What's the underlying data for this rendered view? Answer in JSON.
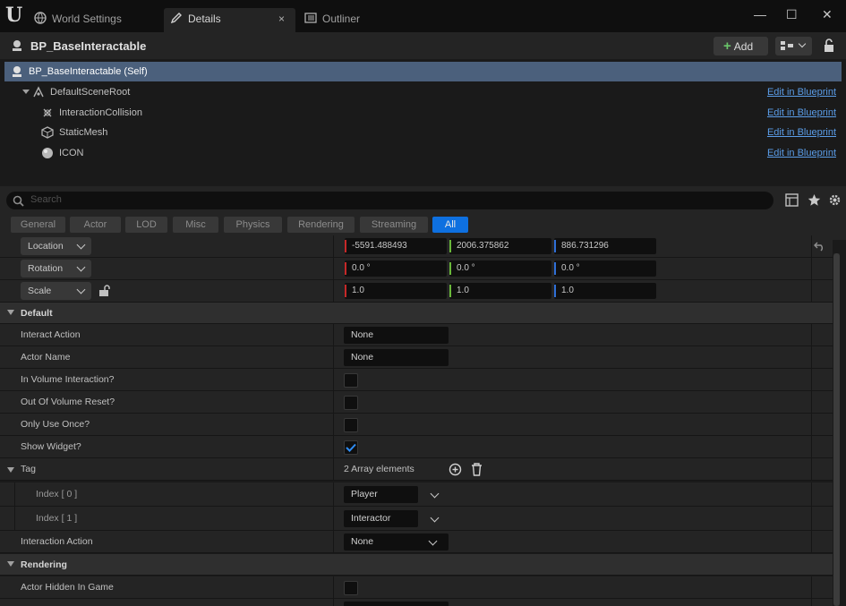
{
  "tabs": [
    {
      "label": "World Settings",
      "icon": "globe-icon"
    },
    {
      "label": "Details",
      "icon": "pencil-icon"
    },
    {
      "label": "Outliner",
      "icon": "outliner-icon"
    }
  ],
  "tab_close": "×",
  "window": {
    "minimize": "—",
    "maximize": "☐",
    "close": "✕"
  },
  "header": {
    "title": "BP_BaseInteractable",
    "add_label": "Add"
  },
  "tree": {
    "items": [
      {
        "label": "BP_BaseInteractable (Self)",
        "icon": "actor-icon",
        "link": ""
      },
      {
        "label": "DefaultSceneRoot",
        "icon": "scene-root-icon",
        "link": "Edit in Blueprint"
      },
      {
        "label": "InteractionCollision",
        "icon": "collision-icon",
        "link": "Edit in Blueprint"
      },
      {
        "label": "StaticMesh",
        "icon": "mesh-icon",
        "link": "Edit in Blueprint"
      },
      {
        "label": "ICON",
        "icon": "sphere-icon",
        "link": "Edit in Blueprint"
      }
    ]
  },
  "search": {
    "placeholder": "Search"
  },
  "filter_tabs": [
    "General",
    "Actor",
    "LOD",
    "Misc",
    "Physics",
    "Rendering",
    "Streaming",
    "All"
  ],
  "transform": {
    "location": {
      "label": "Location",
      "x": "-5591.488493",
      "y": "2006.375862",
      "z": "886.731296"
    },
    "rotation": {
      "label": "Rotation",
      "x": "0.0 °",
      "y": "0.0 °",
      "z": "0.0 °"
    },
    "scale": {
      "label": "Scale",
      "x": "1.0",
      "y": "1.0",
      "z": "1.0"
    }
  },
  "axis_colors": {
    "x": "#c62828",
    "y": "#6ab83a",
    "z": "#2f6fd6"
  },
  "default_section": {
    "title": "Default",
    "interact_action": {
      "label": "Interact Action",
      "value": "None"
    },
    "actor_name": {
      "label": "Actor Name",
      "value": "None"
    },
    "in_volume": {
      "label": "In Volume Interaction?",
      "checked": false
    },
    "out_of_volume": {
      "label": "Out Of Volume Reset?",
      "checked": false
    },
    "only_use_once": {
      "label": "Only Use Once?",
      "checked": false
    },
    "show_widget": {
      "label": "Show Widget?",
      "checked": true
    },
    "tag": {
      "label": "Tag",
      "count": "2 Array elements",
      "elements": [
        {
          "label": "Index [ 0 ]",
          "value": "Player"
        },
        {
          "label": "Index [ 1 ]",
          "value": "Interactor"
        }
      ]
    },
    "interaction_action": {
      "label": "Interaction Action",
      "value": "None"
    }
  },
  "rendering_section": {
    "title": "Rendering",
    "actor_hidden": {
      "label": "Actor Hidden In Game",
      "checked": false
    }
  },
  "accent_color": "#0e70e0"
}
